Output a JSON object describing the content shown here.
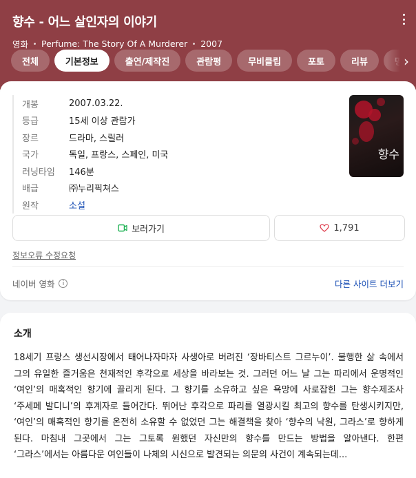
{
  "header": {
    "title": "향수 - 어느 살인자의 이야기",
    "category": "영화",
    "original_title": "Perfume: The Story Of A Murderer",
    "year": "2007",
    "tabs": [
      "전체",
      "기본정보",
      "출연/제작진",
      "관람평",
      "무비클립",
      "포토",
      "리뷰",
      "명대"
    ],
    "active_tab_index": 1,
    "bg_color": "#8f3f45"
  },
  "info": {
    "rows": [
      {
        "key": "개봉",
        "value": "2007.03.22."
      },
      {
        "key": "등급",
        "value": "15세 이상 관람가"
      },
      {
        "key": "장르",
        "value": "드라마, 스릴러"
      },
      {
        "key": "국가",
        "value": "독일, 프랑스, 스페인, 미국"
      },
      {
        "key": "러닝타임",
        "value": "146분"
      },
      {
        "key": "배급",
        "value": "㈜누리픽쳐스"
      },
      {
        "key": "원작",
        "value": "소설"
      }
    ],
    "poster_text": "향수"
  },
  "actions": {
    "watch_label": "보러가기",
    "like_count": "1,791",
    "report_label": "정보오류 수정요청",
    "source_label": "네이버 영화",
    "more_sites_label": "다른 사이트 더보기"
  },
  "intro": {
    "title": "소개",
    "text": "18세기 프랑스 생선시장에서 태어나자마자 사생아로 버려진 ‘장바티스트 그르누이’. 불행한 삶 속에서 그의 유일한 즐거움은 천재적인 후각으로 세상을 바라보는 것. 그러던 어느 날 그는 파리에서 운명적인 ‘여인’의 매혹적인 향기에 끌리게 된다. 그 향기를 소유하고 싶은 욕망에 사로잡힌 그는 향수제조사 ‘주세페 발디니’의 후계자로 들어간다. 뛰어난 후각으로 파리를 열광시킬 최고의 향수를 탄생시키지만, ‘여인’의 매혹적인 향기를 온전히 소유할 수 없었던 그는 해결책을 찾아 ‘향수의 낙원, 그라스’로 향하게 된다. 마침내 그곳에서 그는 그토록 원했던 자신만의 향수를 만드는 방법을 알아낸다. 한편 ‘그라스’에서는 아름다운 여인들이 나체의 시신으로 발견되는 의문의 사건이 계속되는데..."
  }
}
